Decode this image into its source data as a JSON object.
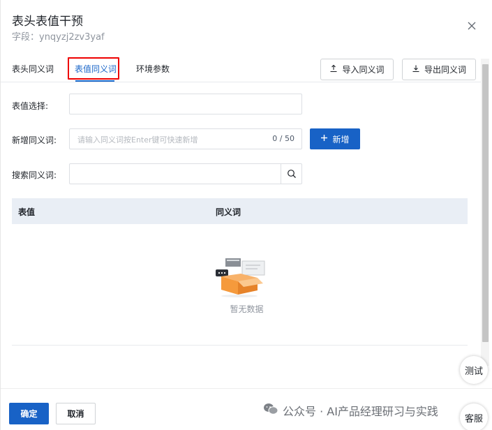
{
  "dialog": {
    "title": "表头表值干预",
    "subtitle": "字段：ynqyzj2zv3yaf"
  },
  "tabs": [
    {
      "label": "表头同义词",
      "active": false
    },
    {
      "label": "表值同义词",
      "active": true
    },
    {
      "label": "环境参数",
      "active": false
    }
  ],
  "toolbar": {
    "import_label": "导入同义词",
    "export_label": "导出同义词"
  },
  "form": {
    "value_select_label": "表值选择:",
    "value_select_value": "",
    "add_synonym_label": "新增同义词:",
    "add_synonym_placeholder": "请输入同义词按Enter键可快速新增",
    "add_synonym_counter": "0 / 50",
    "add_button_label": "新增",
    "search_label": "搜索同义词:",
    "search_value": ""
  },
  "table": {
    "columns": [
      "表值",
      "同义词"
    ],
    "rows": [],
    "empty_text": "暂无数据"
  },
  "footer": {
    "ok_label": "确定",
    "cancel_label": "取消"
  },
  "floating": {
    "test_label": "测试",
    "service_label": "客服"
  },
  "watermark": {
    "text": "公众号 · AI产品经理研习与实践"
  },
  "colors": {
    "primary": "#1862c6",
    "tab_active": "#1a66c9",
    "highlight": "#ee0000",
    "table_header_bg": "#e9eef5"
  }
}
